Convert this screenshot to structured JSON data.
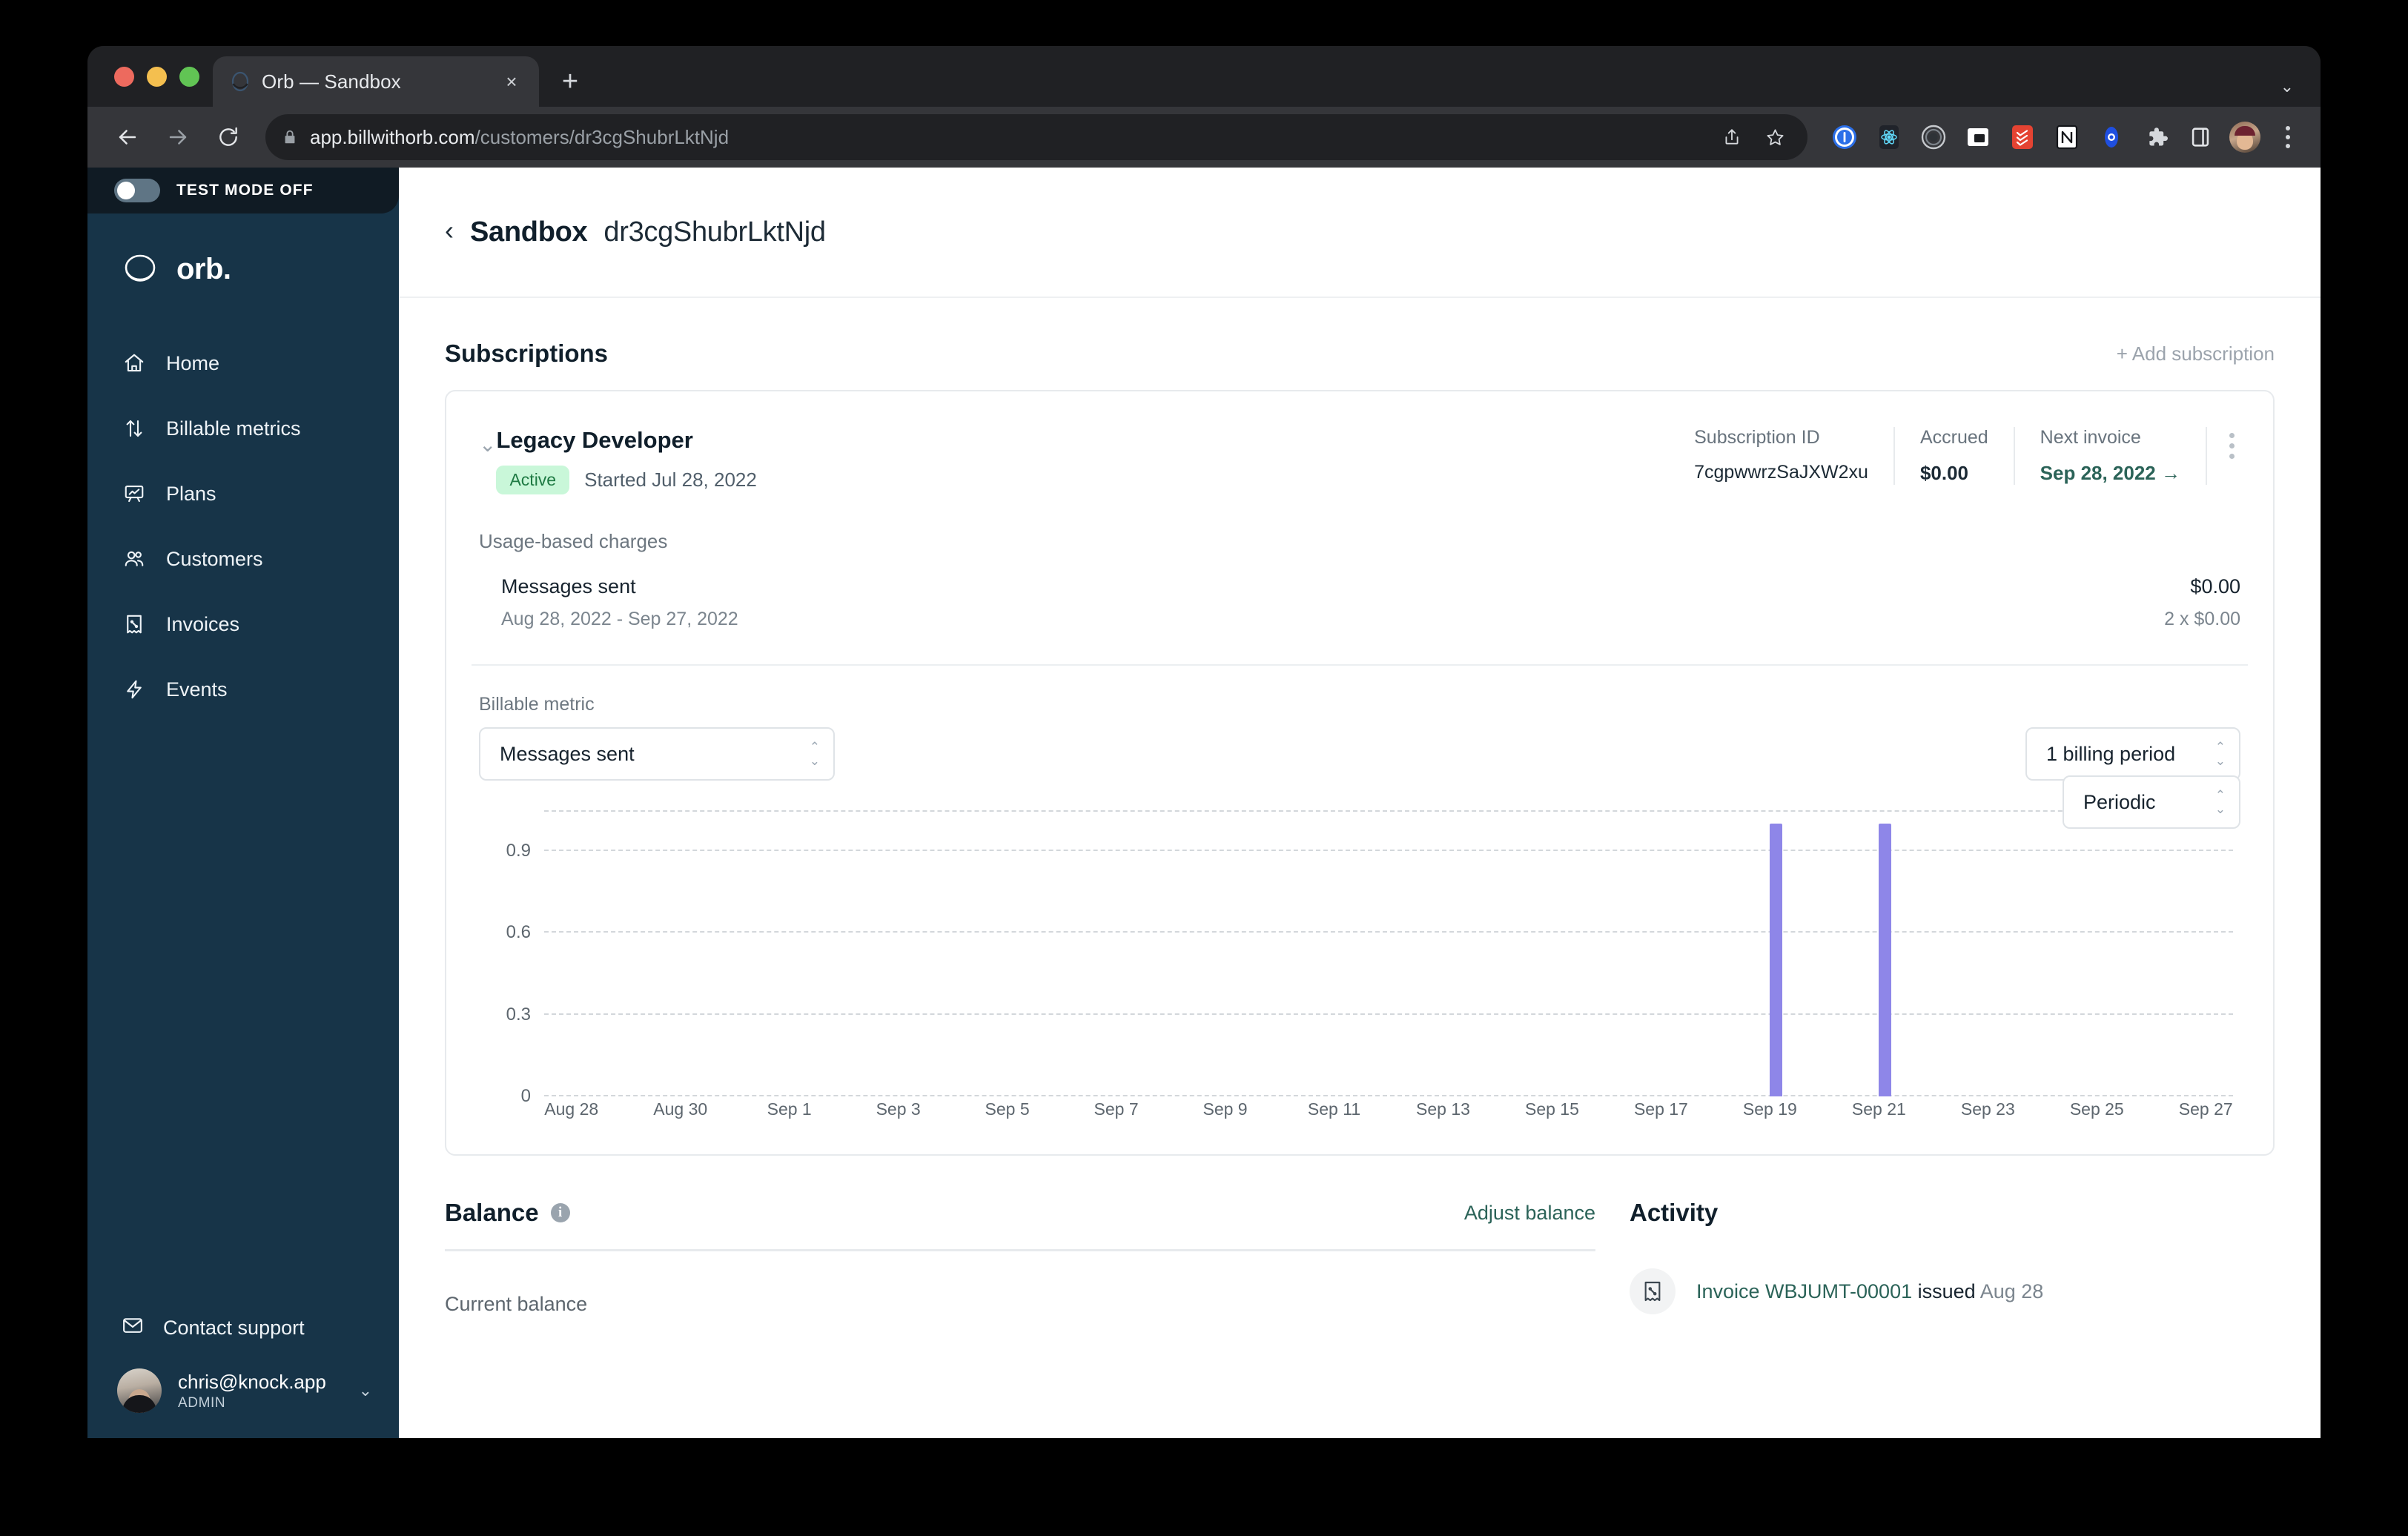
{
  "browser": {
    "tab": {
      "title": "Orb — Sandbox",
      "favicon": "orb-logo-icon",
      "close": "×"
    },
    "new_tab_label": "+",
    "tabstrip_caret": "⌄",
    "url": {
      "host": "app.billwithorb.com",
      "path": "/customers/dr3cgShubrLktNjd"
    },
    "nav": {
      "back": "back-icon",
      "forward": "forward-icon",
      "reload": "reload-icon"
    },
    "omni_actions": [
      "share-icon",
      "bookmark-star-icon"
    ],
    "extensions": [
      "1password-icon",
      "react-devtools-icon",
      "vimeo-record-icon",
      "picture-in-picture-icon",
      "todoist-icon",
      "notion-icon",
      "orb-extension-icon",
      "puzzle-extensions-icon",
      "side-panel-icon"
    ],
    "profile": "profile-avatar",
    "menu": "chrome-menu-icon"
  },
  "sidebar": {
    "test_mode_label": "TEST MODE OFF",
    "test_mode_on": false,
    "brand": "orb.",
    "items": [
      {
        "label": "Home",
        "icon": "home-icon"
      },
      {
        "label": "Billable metrics",
        "icon": "arrows-up-down-icon"
      },
      {
        "label": "Plans",
        "icon": "presentation-chart-icon"
      },
      {
        "label": "Customers",
        "icon": "users-icon"
      },
      {
        "label": "Invoices",
        "icon": "invoice-receipt-icon"
      },
      {
        "label": "Events",
        "icon": "lightning-bolt-icon"
      }
    ],
    "support_label": "Contact support",
    "user": {
      "email": "chris@knock.app",
      "role": "ADMIN",
      "caret": "⌄"
    }
  },
  "header": {
    "back_caret": "‹",
    "title": "Sandbox",
    "customer_id": "dr3cgShubrLktNjd"
  },
  "subscriptions": {
    "section_title": "Subscriptions",
    "add_label": "+ Add subscription",
    "item": {
      "name": "Legacy Developer",
      "status": "Active",
      "started": "Started Jul 28, 2022",
      "meta": [
        {
          "label": "Subscription ID",
          "value": "7cgpwwrzSaJXW2xu"
        },
        {
          "label": "Accrued",
          "value": "$0.00"
        },
        {
          "label": "Next invoice",
          "value": "Sep 28, 2022 →"
        }
      ],
      "charges_label": "Usage-based charges",
      "charges": [
        {
          "name": "Messages sent",
          "period": "Aug 28, 2022 - Sep 27, 2022",
          "amount": "$0.00",
          "quantity": "2 x $0.00"
        }
      ]
    }
  },
  "chart_controls": {
    "metric_label": "Billable metric",
    "metric_value": "Messages sent",
    "period_value": "1 billing period",
    "granularity_value": "Periodic"
  },
  "chart_data": {
    "type": "bar",
    "title": "",
    "xlabel": "",
    "ylabel": "",
    "ylim": [
      0,
      1.05
    ],
    "yticks": [
      0,
      0.3,
      0.6,
      0.9
    ],
    "ytick_labels": [
      "0",
      "0.3",
      "0.6",
      "0.9"
    ],
    "grid": true,
    "legend": "none",
    "bar_color": "#8e86e8",
    "categories": [
      "Aug 28",
      "Aug 29",
      "Aug 30",
      "Aug 31",
      "Sep 1",
      "Sep 2",
      "Sep 3",
      "Sep 4",
      "Sep 5",
      "Sep 6",
      "Sep 7",
      "Sep 8",
      "Sep 9",
      "Sep 10",
      "Sep 11",
      "Sep 12",
      "Sep 13",
      "Sep 14",
      "Sep 15",
      "Sep 16",
      "Sep 17",
      "Sep 18",
      "Sep 19",
      "Sep 20",
      "Sep 21",
      "Sep 22",
      "Sep 23",
      "Sep 24",
      "Sep 25",
      "Sep 26",
      "Sep 27"
    ],
    "values": [
      0,
      0,
      0,
      0,
      0,
      0,
      0,
      0,
      0,
      0,
      0,
      0,
      0,
      0,
      0,
      0,
      0,
      0,
      0,
      0,
      0,
      0,
      1,
      0,
      1,
      0,
      0,
      0,
      0,
      0,
      0
    ],
    "tick_labels": [
      "Aug 28",
      "Aug 30",
      "Sep 1",
      "Sep 3",
      "Sep 5",
      "Sep 7",
      "Sep 9",
      "Sep 11",
      "Sep 13",
      "Sep 15",
      "Sep 17",
      "Sep 19",
      "Sep 21",
      "Sep 23",
      "Sep 25",
      "Sep 27"
    ]
  },
  "balance": {
    "title": "Balance",
    "info_icon": "info-icon",
    "adjust_label": "Adjust balance",
    "current_label": "Current balance"
  },
  "activity": {
    "title": "Activity",
    "items": [
      {
        "icon": "invoice-receipt-icon",
        "link_text": "Invoice WBJUMT-00001",
        "mid_text": "issued",
        "date_text": "Aug 28"
      }
    ]
  }
}
